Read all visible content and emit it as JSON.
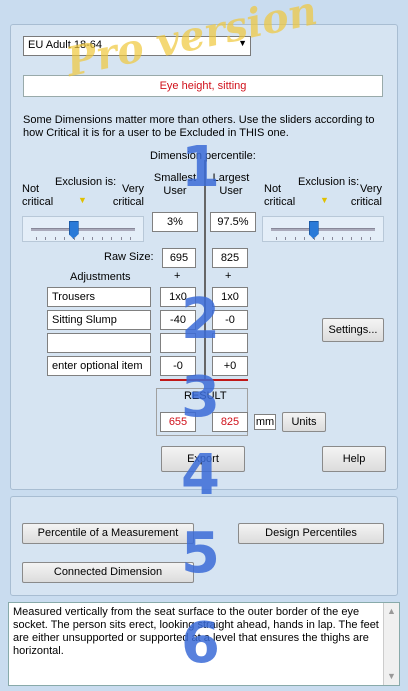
{
  "dataset": {
    "selected": "EU Adult 18-64"
  },
  "dimension_name": "Eye height, sitting",
  "watermark": "Pro version",
  "instructions": "Some Dimensions matter more than others. Use the sliders according to how Critical it is for a user to be Excluded in THIS one.",
  "dimension_percentile_label": "Dimension percentile:",
  "left_exclusion": {
    "title": "Exclusion is:",
    "low": "Not critical",
    "high": "Very critical",
    "level": 0.4
  },
  "right_exclusion": {
    "title": "Exclusion is:",
    "low": "Not critical",
    "high": "Very critical",
    "level": 0.4
  },
  "smallest_user": {
    "label": "Smallest User",
    "percentile": "3%",
    "raw": "695",
    "adj1": "1x0",
    "adj2": "-40",
    "adj3": "",
    "adj4": "-0",
    "result": "655"
  },
  "largest_user": {
    "label": "Largest User",
    "percentile": "97.5%",
    "raw": "825",
    "adj1": "1x0",
    "adj2": "-0",
    "adj3": "",
    "adj4": "+0",
    "result": "825"
  },
  "raw_size_label": "Raw Size:",
  "adjustments_label": "Adjustments",
  "plus": "+",
  "adjust_items": [
    "Trousers",
    "Sitting Slump",
    "",
    "enter optional item"
  ],
  "result_label": "RESULT",
  "unit": "mm",
  "buttons": {
    "settings": "Settings...",
    "units": "Units",
    "export": "Export",
    "help": "Help",
    "percentile_of_measurement": "Percentile of a Measurement",
    "design_percentiles": "Design Percentiles",
    "connected_dimension": "Connected Dimension"
  },
  "step_numbers": [
    "1",
    "2",
    "3",
    "4",
    "5",
    "6"
  ],
  "description": "Measured vertically from the seat surface to the outer border of the eye socket.  The person sits erect, looking straight ahead, hands in lap. The feet are either unsupported or supported at a level that ensures the thighs are horizontal."
}
